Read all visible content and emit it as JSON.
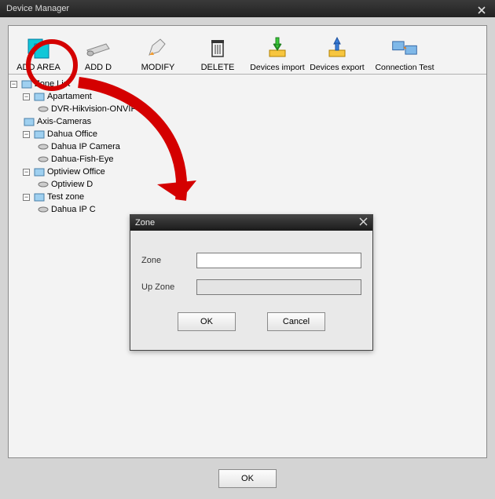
{
  "window": {
    "title": "Device Manager"
  },
  "toolbar": {
    "add_area": "ADD AREA",
    "add_device": "ADD D",
    "modify": "MODIFY",
    "delete": "DELETE",
    "devices_import": "Devices import",
    "devices_export": "Devices export",
    "connection_test": "Connection Test"
  },
  "tree": {
    "root": "Zone List",
    "nodes": [
      {
        "label": "Apartament",
        "children": [
          "DVR-Hikvision-ONVIF"
        ]
      },
      {
        "label": "Axis-Cameras",
        "children": []
      },
      {
        "label": "Dahua Office",
        "children": [
          "Dahua IP Camera",
          "Dahua-Fish-Eye"
        ]
      },
      {
        "label": "Optiview Office",
        "children": [
          "Optiview D"
        ]
      },
      {
        "label": "Test zone",
        "children": [
          "Dahua IP C"
        ]
      }
    ]
  },
  "zone_dialog": {
    "title": "Zone",
    "field_zone": "Zone",
    "field_upzone": "Up Zone",
    "zone_value": "",
    "upzone_value": "",
    "ok": "OK",
    "cancel": "Cancel"
  },
  "footer": {
    "ok": "OK"
  }
}
